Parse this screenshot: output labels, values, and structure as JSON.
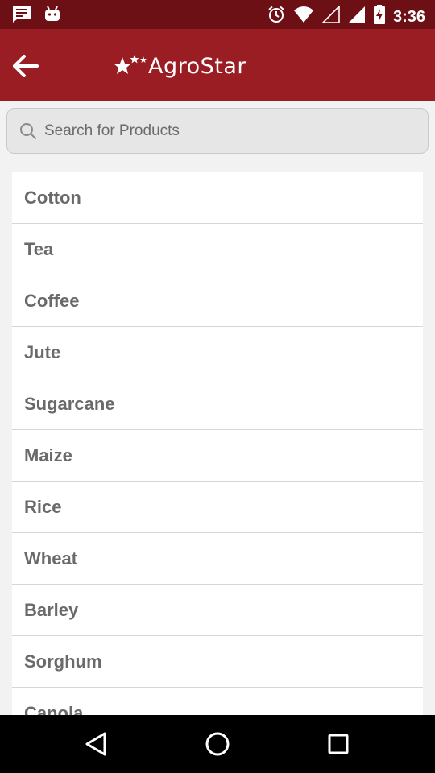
{
  "status_bar": {
    "time": "3:36",
    "icons": [
      "message-icon",
      "android-icon",
      "alarm-icon",
      "wifi-icon",
      "signal-empty-icon",
      "signal-icon",
      "battery-charging-icon"
    ]
  },
  "app_bar": {
    "back_icon": "arrow-left-icon",
    "logo_text": "AgroStar"
  },
  "search": {
    "placeholder": "Search for Products",
    "value": ""
  },
  "crops": [
    {
      "label": "Cotton"
    },
    {
      "label": "Tea"
    },
    {
      "label": "Coffee"
    },
    {
      "label": "Jute"
    },
    {
      "label": "Sugarcane"
    },
    {
      "label": "Maize"
    },
    {
      "label": "Rice"
    },
    {
      "label": "Wheat"
    },
    {
      "label": "Barley"
    },
    {
      "label": "Sorghum"
    },
    {
      "label": "Canola"
    }
  ],
  "nav_bar": {
    "icons": [
      "back-triangle-icon",
      "home-circle-icon",
      "recents-square-icon"
    ]
  },
  "colors": {
    "status_bar": "#6d1016",
    "app_bar": "#9a1d24",
    "list_text": "#6a6a6a",
    "background": "#f2f2f2"
  }
}
